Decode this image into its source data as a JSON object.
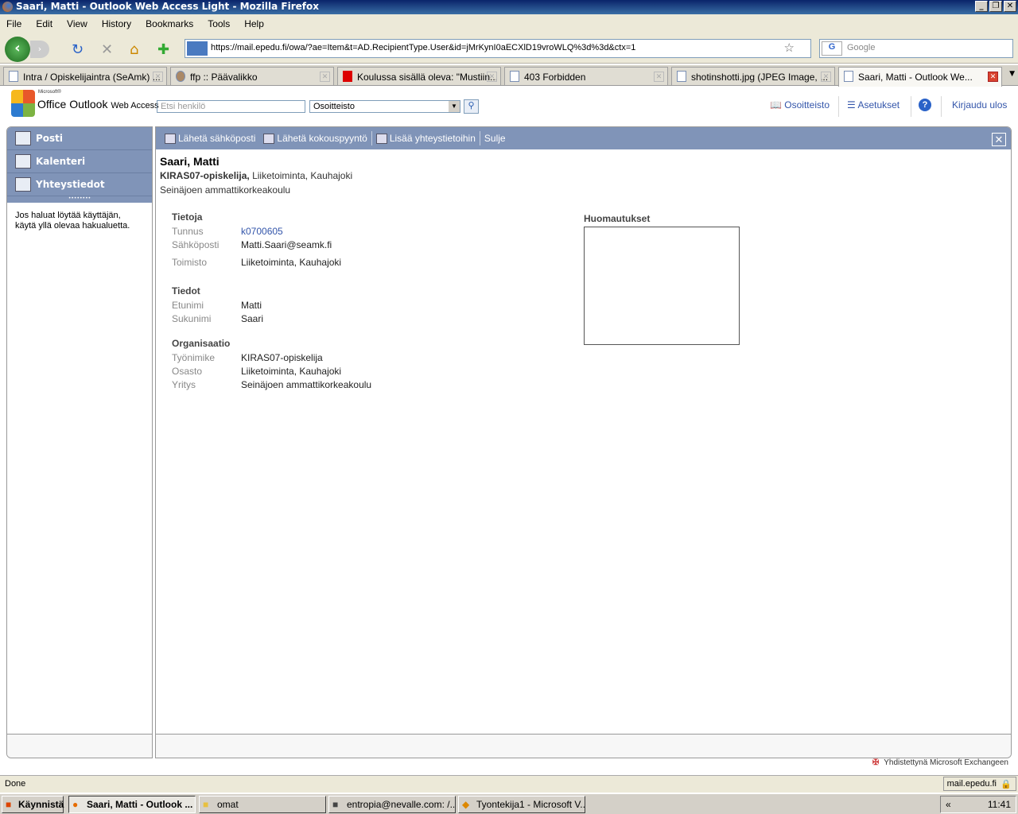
{
  "window": {
    "title": "Saari, Matti - Outlook Web Access Light - Mozilla Firefox",
    "buttons": [
      "_",
      "❐",
      "✕"
    ]
  },
  "menu": [
    "File",
    "Edit",
    "View",
    "History",
    "Bookmarks",
    "Tools",
    "Help"
  ],
  "url": "https://mail.epedu.fi/owa/?ae=Item&t=AD.RecipientType.User&id=jMrKynI0aECXlD19vroWLQ%3d%3d&ctx=1",
  "search_placeholder": "Google",
  "tabs": [
    "Intra / Opiskelijaintra (SeAmk) ...",
    "ffp :: Päävalikko",
    "Koulussa sisällä oleva: \"Mustiin...",
    "403 Forbidden",
    "shotinshotti.jpg (JPEG Image, ...",
    "Saari, Matti - Outlook We..."
  ],
  "owa": {
    "logo_ms": "Microsoft®",
    "logo_name": "Office Outlook",
    "logo_sub": "Web Access",
    "find_placeholder": "Etsi henkilö",
    "directory": "Osoitteisto",
    "top_links": {
      "addressbook": "Osoitteisto",
      "options": "Asetukset",
      "logout": "Kirjaudu ulos"
    },
    "nav": [
      "Posti",
      "Kalenteri",
      "Yhteystiedot"
    ],
    "hint": "Jos haluat löytää käyttäjän, käytä yllä olevaa hakualuetta.",
    "toolbar": {
      "send_mail": "Lähetä sähköposti",
      "send_meeting": "Lähetä kokouspyyntö",
      "add_contact": "Lisää yhteystietoihin",
      "close": "Sulje"
    },
    "person": {
      "name": "Saari, Matti",
      "title": "KIRAS07-opiskelija,",
      "dept": "Liiketoiminta, Kauhajoki",
      "company": "Seinäjoen ammattikorkeakoulu"
    },
    "sections": [
      {
        "heading": "Tietoja",
        "rows": [
          {
            "label": "Tunnus",
            "value": "k0700605"
          },
          {
            "label": "Sähköposti",
            "value": "Matti.Saari@seamk.fi"
          },
          {
            "label": "Toimisto",
            "value": "Liiketoiminta, Kauhajoki"
          }
        ]
      },
      {
        "heading": "Tiedot",
        "rows": [
          {
            "label": "Etunimi",
            "value": "Matti"
          },
          {
            "label": "Sukunimi",
            "value": "Saari"
          }
        ]
      },
      {
        "heading": "Organisaatio",
        "rows": [
          {
            "label": "Työnimike",
            "value": "KIRAS07-opiskelija"
          },
          {
            "label": "Osasto",
            "value": "Liiketoiminta, Kauhajoki"
          },
          {
            "label": "Yritys",
            "value": "Seinäjoen ammattikorkeakoulu"
          }
        ]
      }
    ],
    "notes_heading": "Huomautukset",
    "footer": "Yhdistettynä Microsoft Exchangeen"
  },
  "status": {
    "left": "Done",
    "right": "mail.epedu.fi"
  },
  "taskbar": {
    "start": "Käynnistä",
    "items": [
      "Saari, Matti - Outlook ...",
      "omat",
      "entropia@nevalle.com: /...",
      "Tyontekija1 - Microsoft V..."
    ],
    "clock": "11:41"
  }
}
